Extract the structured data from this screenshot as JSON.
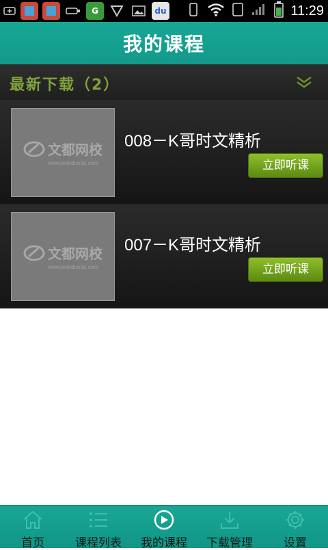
{
  "status_bar": {
    "time": "11:29"
  },
  "header": {
    "title": "我的课程"
  },
  "section": {
    "label": "最新下载（2）"
  },
  "courses": [
    {
      "title": "008－K哥时文精析",
      "action": "立即听课",
      "thumb_brand": "文都网校",
      "thumb_url": "www.wenduedu.com"
    },
    {
      "title": "007－K哥时文精析",
      "action": "立即听课",
      "thumb_brand": "文都网校",
      "thumb_url": "www.wenduedu.com"
    }
  ],
  "nav": {
    "items": [
      {
        "label": "首页",
        "icon": "home-icon"
      },
      {
        "label": "课程列表",
        "icon": "list-icon"
      },
      {
        "label": "我的课程",
        "icon": "play-icon"
      },
      {
        "label": "下载管理",
        "icon": "download-icon"
      },
      {
        "label": "设置",
        "icon": "gear-icon"
      }
    ],
    "active_index": 2
  },
  "colors": {
    "accent": "#13998a",
    "button": "#6f9f1a",
    "section_text": "#7ea33a"
  }
}
